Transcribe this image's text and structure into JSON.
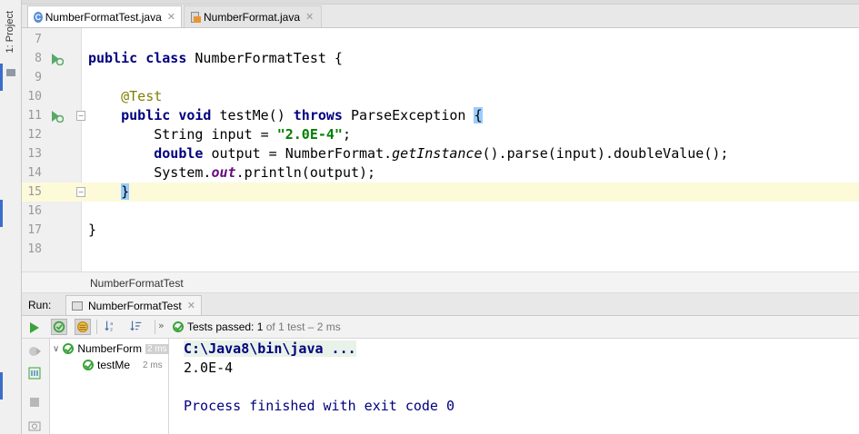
{
  "left_strip": {
    "project_label": "1: Project"
  },
  "tabs": [
    {
      "label": "NumberFormatTest.java",
      "icon": "class-icon",
      "active": true
    },
    {
      "label": "NumberFormat.java",
      "icon": "java-library-icon",
      "active": false
    }
  ],
  "editor": {
    "line_numbers": [
      "7",
      "8",
      "9",
      "10",
      "11",
      "12",
      "13",
      "14",
      "15",
      "16",
      "17",
      "18"
    ],
    "code": {
      "l8_kw1": "public",
      "l8_kw2": "class",
      "l8_name": "NumberFormatTest {",
      "l10_ann": "@Test",
      "l11_kw1": "public",
      "l11_kw2": "void",
      "l11_mid": "testMe()",
      "l11_kw3": "throws",
      "l11_exc": "ParseException",
      "l11_brace": "{",
      "l12_type": "String input =",
      "l12_str": "\"2.0E-4\"",
      "l12_end": ";",
      "l13_kw": "double",
      "l13_a": "output = NumberFormat.",
      "l13_ital": "getInstance",
      "l13_b": "().parse(input).doubleValue();",
      "l14_a": "System.",
      "l14_field": "out",
      "l14_b": ".println(output);",
      "l15_brace": "}",
      "l17_brace": "}"
    }
  },
  "breadcrumb": {
    "label": "NumberFormatTest"
  },
  "run_panel": {
    "run_label": "Run:",
    "run_tab": "NumberFormatTest",
    "status_prefix": "Tests passed:",
    "status_count": "1",
    "status_rest": "of 1 test – 2 ms",
    "tree": [
      {
        "name": "NumberForm",
        "duration": "2 ms"
      },
      {
        "name": "testMe",
        "duration": "2 ms"
      }
    ],
    "console": [
      "C:\\Java8\\bin\\java ...",
      "2.0E-4",
      "",
      "Process finished with exit code 0"
    ]
  },
  "colors": {
    "keyword": "#000080",
    "string": "#008000",
    "annotation": "#808000",
    "field": "#660e7a",
    "success": "#3aa33a",
    "current_line": "#fcfad9"
  }
}
